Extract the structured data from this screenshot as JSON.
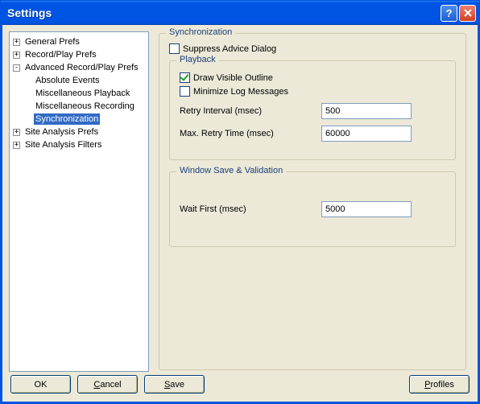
{
  "window": {
    "title": "Settings"
  },
  "tree": {
    "items": [
      {
        "label": "General Prefs",
        "exp": "+"
      },
      {
        "label": "Record/Play Prefs",
        "exp": "+"
      },
      {
        "label": "Advanced Record/Play Prefs",
        "exp": "-"
      },
      {
        "label": "Absolute Events"
      },
      {
        "label": "Miscellaneous Playback"
      },
      {
        "label": "Miscellaneous Recording"
      },
      {
        "label": "Synchronization",
        "selected": true
      },
      {
        "label": "Site Analysis Prefs",
        "exp": "+"
      },
      {
        "label": "Site Analysis Filters",
        "exp": "+"
      }
    ]
  },
  "sync": {
    "legend": "Synchronization",
    "suppress_label": "Suppress Advice Dialog",
    "playback": {
      "legend": "Playback",
      "draw_outline_label": "Draw Visible Outline",
      "minimize_log_label": "Minimize Log Messages",
      "retry_interval_label": "Retry Interval (msec)",
      "retry_interval_value": "500",
      "max_retry_label": "Max. Retry Time (msec)",
      "max_retry_value": "60000"
    },
    "validation": {
      "legend": "Window Save & Validation",
      "wait_first_label": "Wait First (msec)",
      "wait_first_value": "5000"
    }
  },
  "buttons": {
    "ok": "OK",
    "cancel_pre": "",
    "cancel_u": "C",
    "cancel_post": "ancel",
    "save_pre": "",
    "save_u": "S",
    "save_post": "ave",
    "profiles_pre": "",
    "profiles_u": "P",
    "profiles_post": "rofiles"
  }
}
